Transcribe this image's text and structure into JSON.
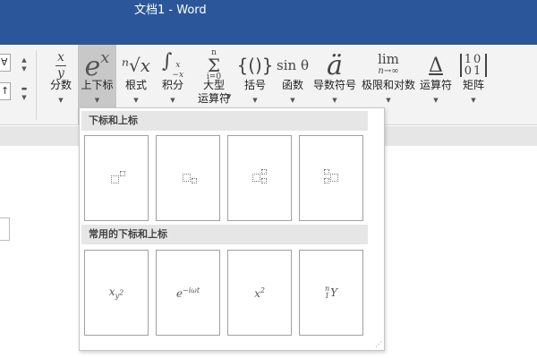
{
  "window": {
    "title": "文档1 - Word"
  },
  "ribbon": {
    "left_fragments": [
      "∀",
      "↑"
    ],
    "buttons": [
      {
        "id": "fraction",
        "label": "分数"
      },
      {
        "id": "script",
        "label": "上下标"
      },
      {
        "id": "radical",
        "label": "根式"
      },
      {
        "id": "integral",
        "label": "积分"
      },
      {
        "id": "large-operator",
        "label": "大型\n运算符"
      },
      {
        "id": "bracket",
        "label": "括号"
      },
      {
        "id": "function",
        "label": "函数"
      },
      {
        "id": "accent",
        "label": "导数符号"
      },
      {
        "id": "limit-log",
        "label": "极限和对数"
      },
      {
        "id": "operator",
        "label": "运算符"
      },
      {
        "id": "matrix",
        "label": "矩阵"
      }
    ],
    "icon_text": {
      "fraction_num": "x",
      "fraction_den": "y",
      "script_base": "e",
      "script_sup": "x",
      "radical": "ⁿ√x",
      "integral_sym": "∫",
      "integral_upper": "x",
      "integral_lower": "−x",
      "sum_upper": "n",
      "sum_sym": "Σ",
      "sum_lower": "i=0",
      "bracket": "{()}",
      "function": "sin θ",
      "accent": "ä",
      "limit_top": "lim",
      "limit_bottom": "n→∞",
      "operator": "Δ",
      "matrix_row1": "10",
      "matrix_row2": "01"
    }
  },
  "dropdown": {
    "sections": [
      {
        "title": "下标和上标"
      },
      {
        "title": "常用的下标和上标"
      }
    ],
    "common_formulas": [
      {
        "base": "x",
        "sub": "y",
        "sup": "2"
      },
      {
        "base": "e",
        "sup": "−iωt"
      },
      {
        "base": "x",
        "sup": "2"
      },
      {
        "pre_sup": "n",
        "pre_sub": "1",
        "base": "Y"
      }
    ]
  },
  "colors": {
    "title_bar": "#2b579a",
    "ribbon_bg": "#f3f3f3",
    "selected_button": "#c8c8c8",
    "section_header": "#e6e6e6"
  }
}
